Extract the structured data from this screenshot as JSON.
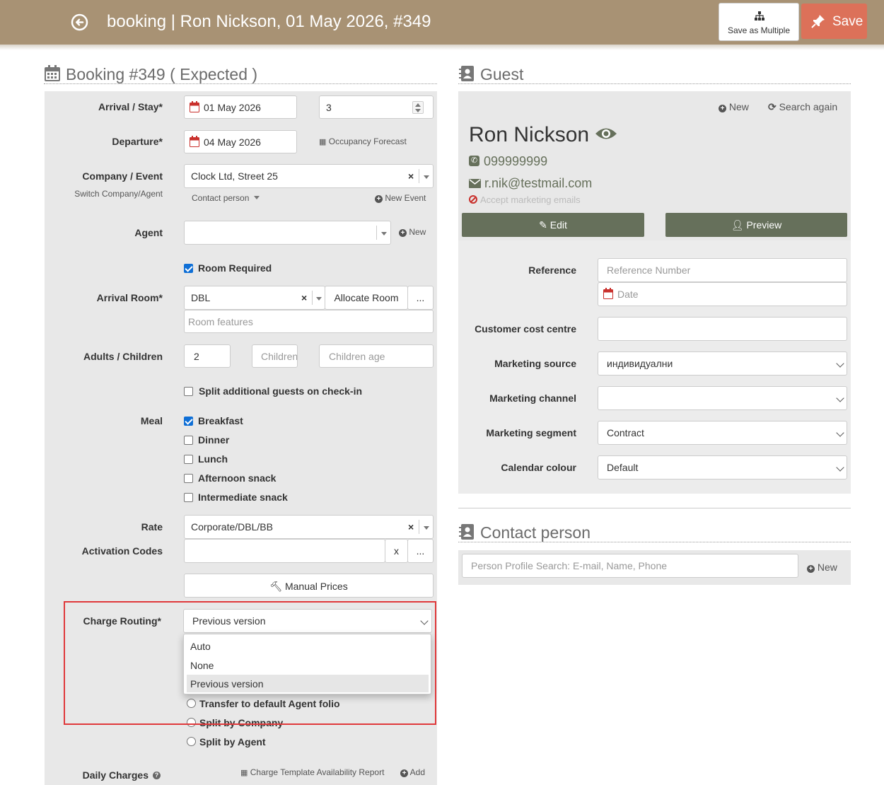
{
  "header": {
    "title": "booking | Ron Nickson, 01 May 2026, #349",
    "save_multiple_label": "Save as Multiple",
    "save_label": "Save"
  },
  "booking": {
    "heading": "Booking #349 ( Expected )",
    "arrival_label": "Arrival / Stay*",
    "arrival_date": "01 May 2026",
    "stay_nights": "3",
    "departure_label": "Departure*",
    "departure_date": "04 May 2026",
    "occupancy_forecast": "Occupancy Forecast",
    "company_label": "Company / Event",
    "switch_label": "Switch Company/Agent",
    "company_value": "Clock Ltd, Street 25",
    "clear_x": "×",
    "contact_person_link": "Contact person",
    "new_event": "New Event",
    "agent_label": "Agent",
    "agent_new": "New",
    "room_required": "Room Required",
    "arrival_room_label": "Arrival Room*",
    "arrival_room_value": "DBL",
    "allocate_room": "Allocate Room",
    "ellipsis": "...",
    "room_features_ph": "Room features",
    "adults_label": "Adults / Children",
    "adults_value": "2",
    "children_ph": "Children",
    "children_age_ph": "Children age",
    "split_guests": "Split additional guests on check-in",
    "meal_label": "Meal",
    "meals": [
      {
        "label": "Breakfast",
        "checked": true
      },
      {
        "label": "Dinner",
        "checked": false
      },
      {
        "label": "Lunch",
        "checked": false
      },
      {
        "label": "Afternoon snack",
        "checked": false
      },
      {
        "label": "Intermediate snack",
        "checked": false
      }
    ],
    "rate_label": "Rate",
    "rate_value": "Corporate/DBL/BB",
    "activation_label": "Activation Codes",
    "activation_x": "x",
    "manual_prices": "Manual Prices",
    "charge_routing_label": "Charge Routing*",
    "charge_routing_value": "Previous version",
    "charge_routing_options": [
      "Auto",
      "None",
      "Previous version"
    ],
    "routing_radios": [
      "Transfer to default Agent folio",
      "Split by Company",
      "Split by Agent"
    ],
    "daily_charges_label": "Daily Charges",
    "charge_template_report": "Charge Template Availability Report",
    "add_label": "Add"
  },
  "guest": {
    "heading": "Guest",
    "new_label": "New",
    "search_again": "Search again",
    "name": "Ron Nickson",
    "phone": "099999999",
    "email": "r.nik@testmail.com",
    "marketing_note": "Accept marketing emails",
    "edit_label": "Edit",
    "preview_label": "Preview",
    "reference_label": "Reference",
    "reference_ph": "Reference Number",
    "date_ph": "Date",
    "cost_centre_label": "Customer cost centre",
    "marketing_source_label": "Marketing source",
    "marketing_source_value": "индивидуални",
    "marketing_channel_label": "Marketing channel",
    "marketing_channel_value": "",
    "marketing_segment_label": "Marketing segment",
    "marketing_segment_value": "Contract",
    "calendar_colour_label": "Calendar colour",
    "calendar_colour_value": "Default"
  },
  "contact": {
    "heading": "Contact person",
    "search_ph": "Person Profile Search: E-mail, Name, Phone",
    "new_label": "New"
  },
  "colors": {
    "header_bg": "#a89274",
    "save_bg": "#dc7159",
    "green_button": "#66705b",
    "highlight_border": "#e0393b"
  }
}
